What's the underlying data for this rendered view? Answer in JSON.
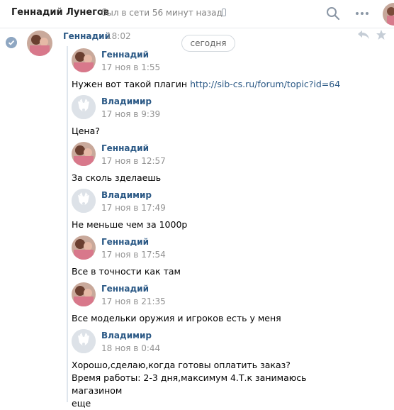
{
  "header": {
    "name": "Геннадий Лунегов",
    "status": "был в сети 56 минут назад"
  },
  "top_message": {
    "sender": "Геннадий",
    "time": "18:02",
    "date_badge": "сегодня"
  },
  "forwarded": [
    {
      "sender": "Геннадий",
      "date": "17 ноя в 1:55",
      "text": "Нужен вот такой плагин ",
      "link": "http://sib-cs.ru/forum/topic?id=64",
      "avatar": "photo"
    },
    {
      "sender": "Владимир",
      "date": "17 ноя в 9:39",
      "text": "Цена?",
      "avatar": "default"
    },
    {
      "sender": "Геннадий",
      "date": "17 ноя в 12:57",
      "text": "За сколь зделаешь",
      "avatar": "photo"
    },
    {
      "sender": "Владимир",
      "date": "17 ноя в 17:49",
      "text": "Не меньше чем за 1000р",
      "avatar": "default"
    },
    {
      "sender": "Геннадий",
      "date": "17 ноя в 17:54",
      "text": "Все в точности как там",
      "avatar": "photo"
    },
    {
      "sender": "Геннадий",
      "date": "17 ноя в 21:35",
      "text": "Все модельки оружия и игроков есть у меня",
      "avatar": "photo"
    },
    {
      "sender": "Владимир",
      "date": "18 ноя в 0:44",
      "text_lines": [
        "Хорошо,сделаю,когда готовы оплатить заказ?",
        "Время работы: 2-3 дня,максимум 4.Т.к занимаюсь магазином",
        "еще"
      ],
      "avatar": "default"
    }
  ]
}
